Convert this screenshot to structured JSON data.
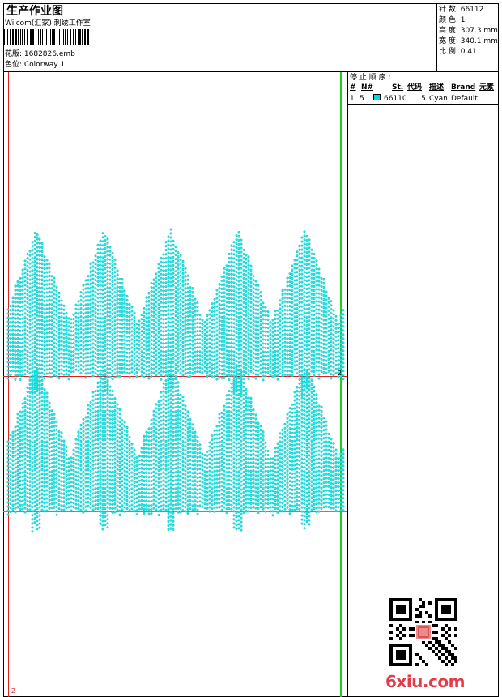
{
  "header": {
    "title": "生产作业图",
    "company": "Wilcom(汇家) 刺绣工作室",
    "design_line": "花版: 1682826.emb",
    "colorway_line": "色位: Colorway 1"
  },
  "stats": {
    "stitches": "针 数: 66112",
    "colors": "颜 色: 1",
    "height": "高 度: 307.3 mm",
    "width": "宽 度: 340.1 mm",
    "ratio": "比 例: 0.41"
  },
  "stop_sequence": {
    "title": "停 止 顺 序 :",
    "columns": [
      "#",
      "N#",
      "St.",
      "代码",
      "描述",
      "Brand",
      "元素"
    ],
    "rows": [
      {
        "index": "1.",
        "needle": "5",
        "swatch_color": "#00d8e8",
        "stitches": "66110",
        "code": "5",
        "desc": "Cyan",
        "brand": "Default"
      }
    ]
  },
  "guides": {
    "corner_label_top": "2",
    "corner_label_bottom": "2"
  },
  "colors": {
    "thread": "#1ee6e6",
    "guide_red": "#e02020",
    "guide_green": "#22cc22"
  },
  "watermark": {
    "site": "6xiu.com",
    "qr_icon": "qr-code-icon"
  }
}
